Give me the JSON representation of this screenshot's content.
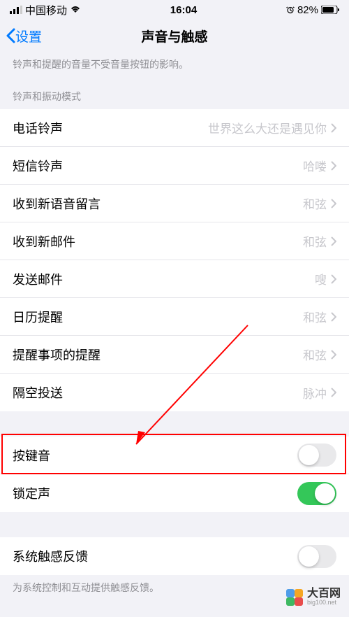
{
  "statusBar": {
    "carrier": "中国移动",
    "time": "16:04",
    "battery": "82%"
  },
  "nav": {
    "back": "设置",
    "title": "声音与触感"
  },
  "description": "铃声和提醒的音量不受音量按钮的影响。",
  "sectionHeader1": "铃声和振动模式",
  "sounds": {
    "ringtone": {
      "label": "电话铃声",
      "value": "世界这么大还是遇见你"
    },
    "textTone": {
      "label": "短信铃声",
      "value": "哈喽"
    },
    "voicemail": {
      "label": "收到新语音留言",
      "value": "和弦"
    },
    "newMail": {
      "label": "收到新邮件",
      "value": "和弦"
    },
    "sentMail": {
      "label": "发送邮件",
      "value": "嗖"
    },
    "calendar": {
      "label": "日历提醒",
      "value": "和弦"
    },
    "reminder": {
      "label": "提醒事项的提醒",
      "value": "和弦"
    },
    "airdrop": {
      "label": "隔空投送",
      "value": "脉冲"
    }
  },
  "toggles": {
    "keyboardClicks": {
      "label": "按键音",
      "on": false
    },
    "lockSound": {
      "label": "锁定声",
      "on": true
    }
  },
  "hapticSection": {
    "systemHaptics": {
      "label": "系统触感反馈",
      "on": false
    },
    "footer": "为系统控制和互动提供触感反馈。"
  },
  "watermark": {
    "name": "大百网",
    "url": "big100.net"
  }
}
